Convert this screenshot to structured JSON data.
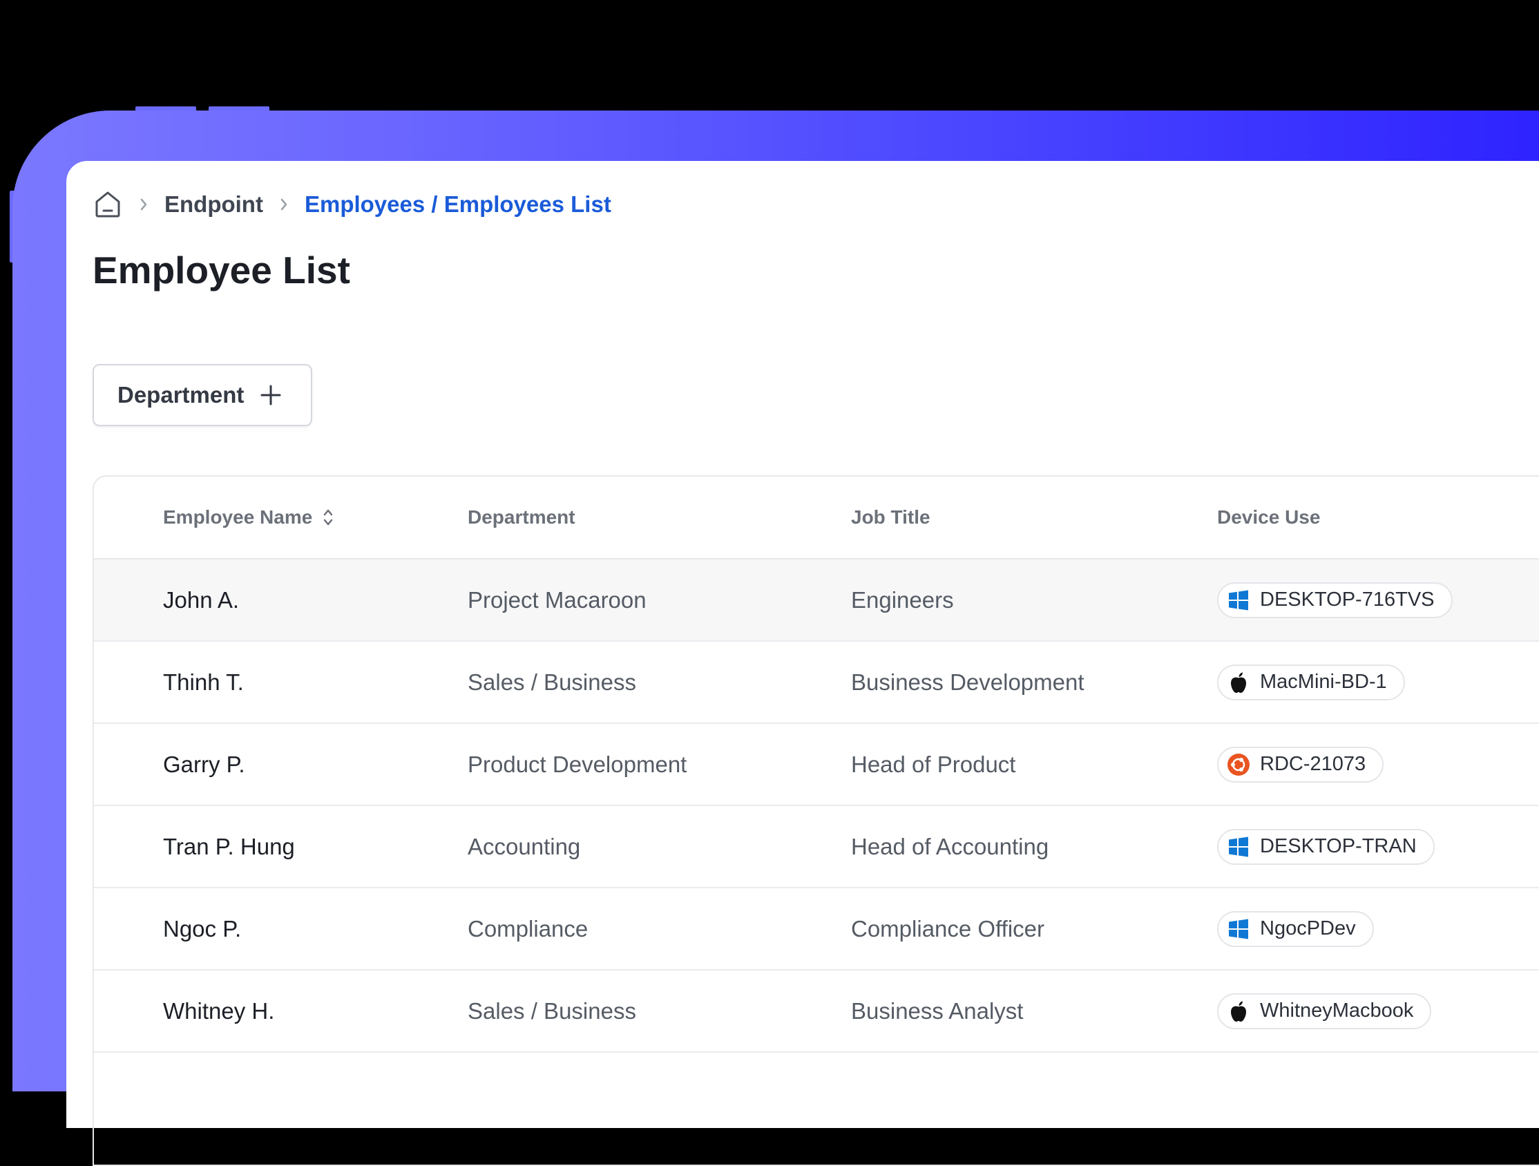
{
  "breadcrumb": {
    "home_icon": "home-icon",
    "items": [
      {
        "label": "Endpoint"
      },
      {
        "label": "Employees / Employees List"
      }
    ]
  },
  "page": {
    "title": "Employee List"
  },
  "filter": {
    "label": "Department",
    "icon": "plus-icon"
  },
  "table": {
    "columns": [
      "Employee Name",
      "Department",
      "Job Title",
      "Device Use"
    ],
    "rows": [
      {
        "name": "John A.",
        "department": "Project Macaroon",
        "job_title": "Engineers",
        "device": "DESKTOP-716TVS",
        "os": "windows"
      },
      {
        "name": "Thinh T.",
        "department": "Sales / Business",
        "job_title": "Business Development",
        "device": "MacMini-BD-1",
        "os": "apple"
      },
      {
        "name": "Garry P.",
        "department": "Product Development",
        "job_title": "Head of Product",
        "device": "RDC-21073",
        "os": "ubuntu"
      },
      {
        "name": "Tran P. Hung",
        "department": "Accounting",
        "job_title": "Head of Accounting",
        "device": "DESKTOP-TRAN",
        "os": "windows"
      },
      {
        "name": "Ngoc P.",
        "department": "Compliance",
        "job_title": "Compliance Officer",
        "device": "NgocPDev",
        "os": "windows"
      },
      {
        "name": "Whitney H.",
        "department": "Sales / Business",
        "job_title": "Business Analyst",
        "device": "WhitneyMacbook",
        "os": "apple"
      }
    ]
  },
  "colors": {
    "frame_gradient_start": "#7b78ff",
    "frame_gradient_end": "#2d22ff",
    "breadcrumb_active": "#1a5bd8",
    "windows_blue": "#0f78d4",
    "ubuntu_orange": "#e95420"
  }
}
